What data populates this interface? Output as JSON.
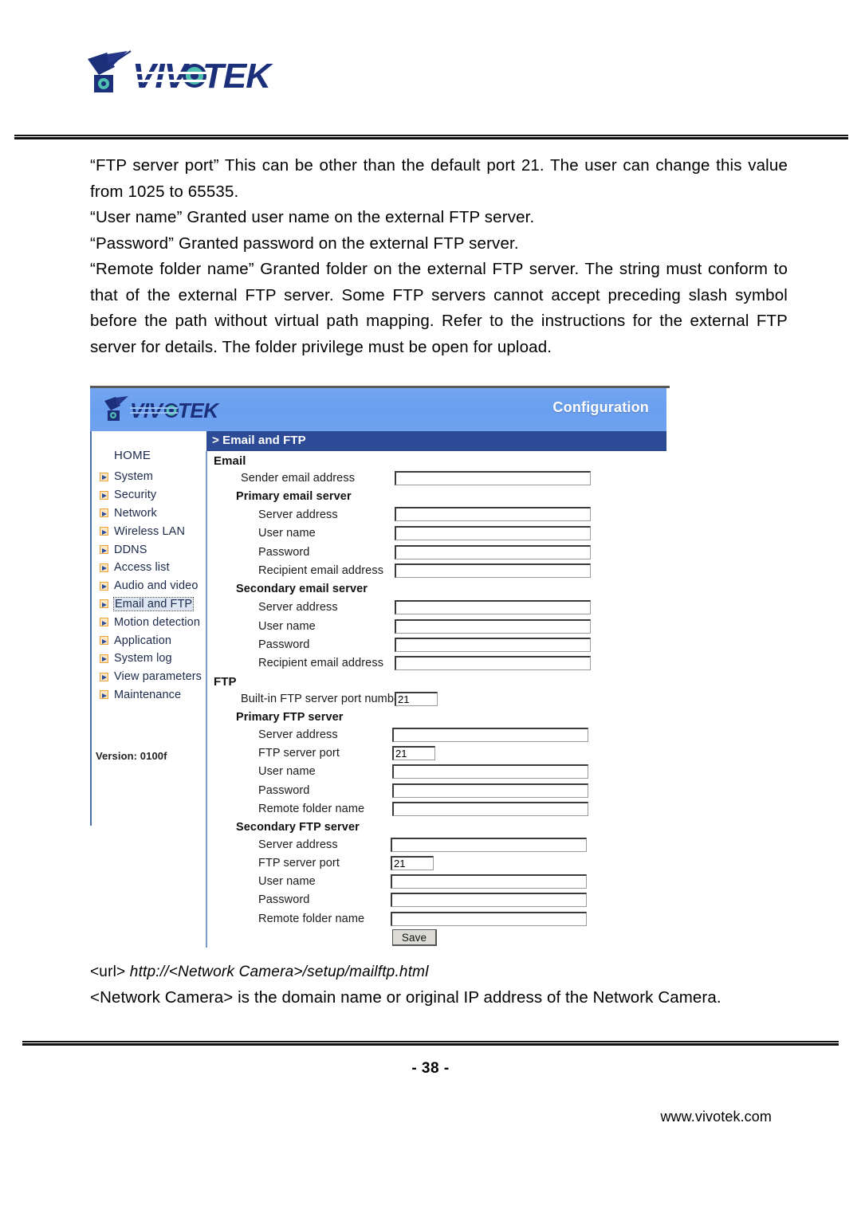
{
  "document": {
    "brand": "VIVOTEK",
    "page_number": "- 38 -",
    "website": "www.vivotek.com",
    "paragraphs": [
      "“FTP server port” This can be other than the default port 21. The user can change this value from 1025 to 65535.",
      "“User name” Granted user name on the external FTP server.",
      "“Password” Granted password on the external FTP server.",
      "“Remote folder name” Granted folder on the external FTP server. The string must conform to that of the external FTP server. Some FTP servers cannot accept preceding slash symbol before the path without virtual path mapping. Refer to the instructions for the external FTP server for details. The folder privilege must be open for upload."
    ],
    "url_note_prefix": "<url>",
    "url_note_value": "http://<Network Camera>/setup/mailftp.html",
    "closing_note": "<Network Camera> is the domain name or original IP address of the Network Camera."
  },
  "screenshot": {
    "header": {
      "logo": "VIVOTEK",
      "title": "Configuration"
    },
    "breadcrumb": "> Email and FTP",
    "sidebar": {
      "home_label": "HOME",
      "items": [
        {
          "label": "System",
          "active": false
        },
        {
          "label": "Security",
          "active": false
        },
        {
          "label": "Network",
          "active": false
        },
        {
          "label": "Wireless LAN",
          "active": false
        },
        {
          "label": "DDNS",
          "active": false
        },
        {
          "label": "Access list",
          "active": false
        },
        {
          "label": "Audio and video",
          "active": false
        },
        {
          "label": "Email and FTP",
          "active": true
        },
        {
          "label": "Motion detection",
          "active": false
        },
        {
          "label": "Application",
          "active": false
        },
        {
          "label": "System log",
          "active": false
        },
        {
          "label": "View parameters",
          "active": false
        },
        {
          "label": "Maintenance",
          "active": false
        }
      ],
      "version": "Version: 0100f"
    },
    "email_section": {
      "title": "Email",
      "sender_label": "Sender email address",
      "sender_value": "",
      "primary": {
        "title": "Primary email server",
        "server_address_label": "Server address",
        "server_address_value": "",
        "user_name_label": "User name",
        "user_name_value": "",
        "password_label": "Password",
        "password_value": "",
        "recipient_label": "Recipient email address",
        "recipient_value": ""
      },
      "secondary": {
        "title": "Secondary email server",
        "server_address_label": "Server address",
        "server_address_value": "",
        "user_name_label": "User name",
        "user_name_value": "",
        "password_label": "Password",
        "password_value": "",
        "recipient_label": "Recipient email address",
        "recipient_value": ""
      }
    },
    "ftp_section": {
      "title": "FTP",
      "builtin_port_label": "Built-in FTP server port number",
      "builtin_port_value": "21",
      "primary": {
        "title": "Primary FTP server",
        "server_address_label": "Server address",
        "server_address_value": "",
        "ftp_port_label": "FTP server port",
        "ftp_port_value": "21",
        "user_name_label": "User name",
        "user_name_value": "",
        "password_label": "Password",
        "password_value": "",
        "remote_folder_label": "Remote folder name",
        "remote_folder_value": ""
      },
      "secondary": {
        "title": "Secondary FTP server",
        "server_address_label": "Server address",
        "server_address_value": "",
        "ftp_port_label": "FTP server port",
        "ftp_port_value": "21",
        "user_name_label": "User name",
        "user_name_value": "",
        "password_label": "Password",
        "password_value": "",
        "remote_folder_label": "Remote folder name",
        "remote_folder_value": ""
      }
    },
    "save_label": "Save"
  },
  "colors": {
    "header_blue": "#6fa3f1",
    "breadcrumb_navy": "#2c4a96",
    "logo_navy": "#1b2f7a",
    "logo_teal": "#4fbfb0",
    "sidebar_icon_orange": "#e8a33d"
  }
}
